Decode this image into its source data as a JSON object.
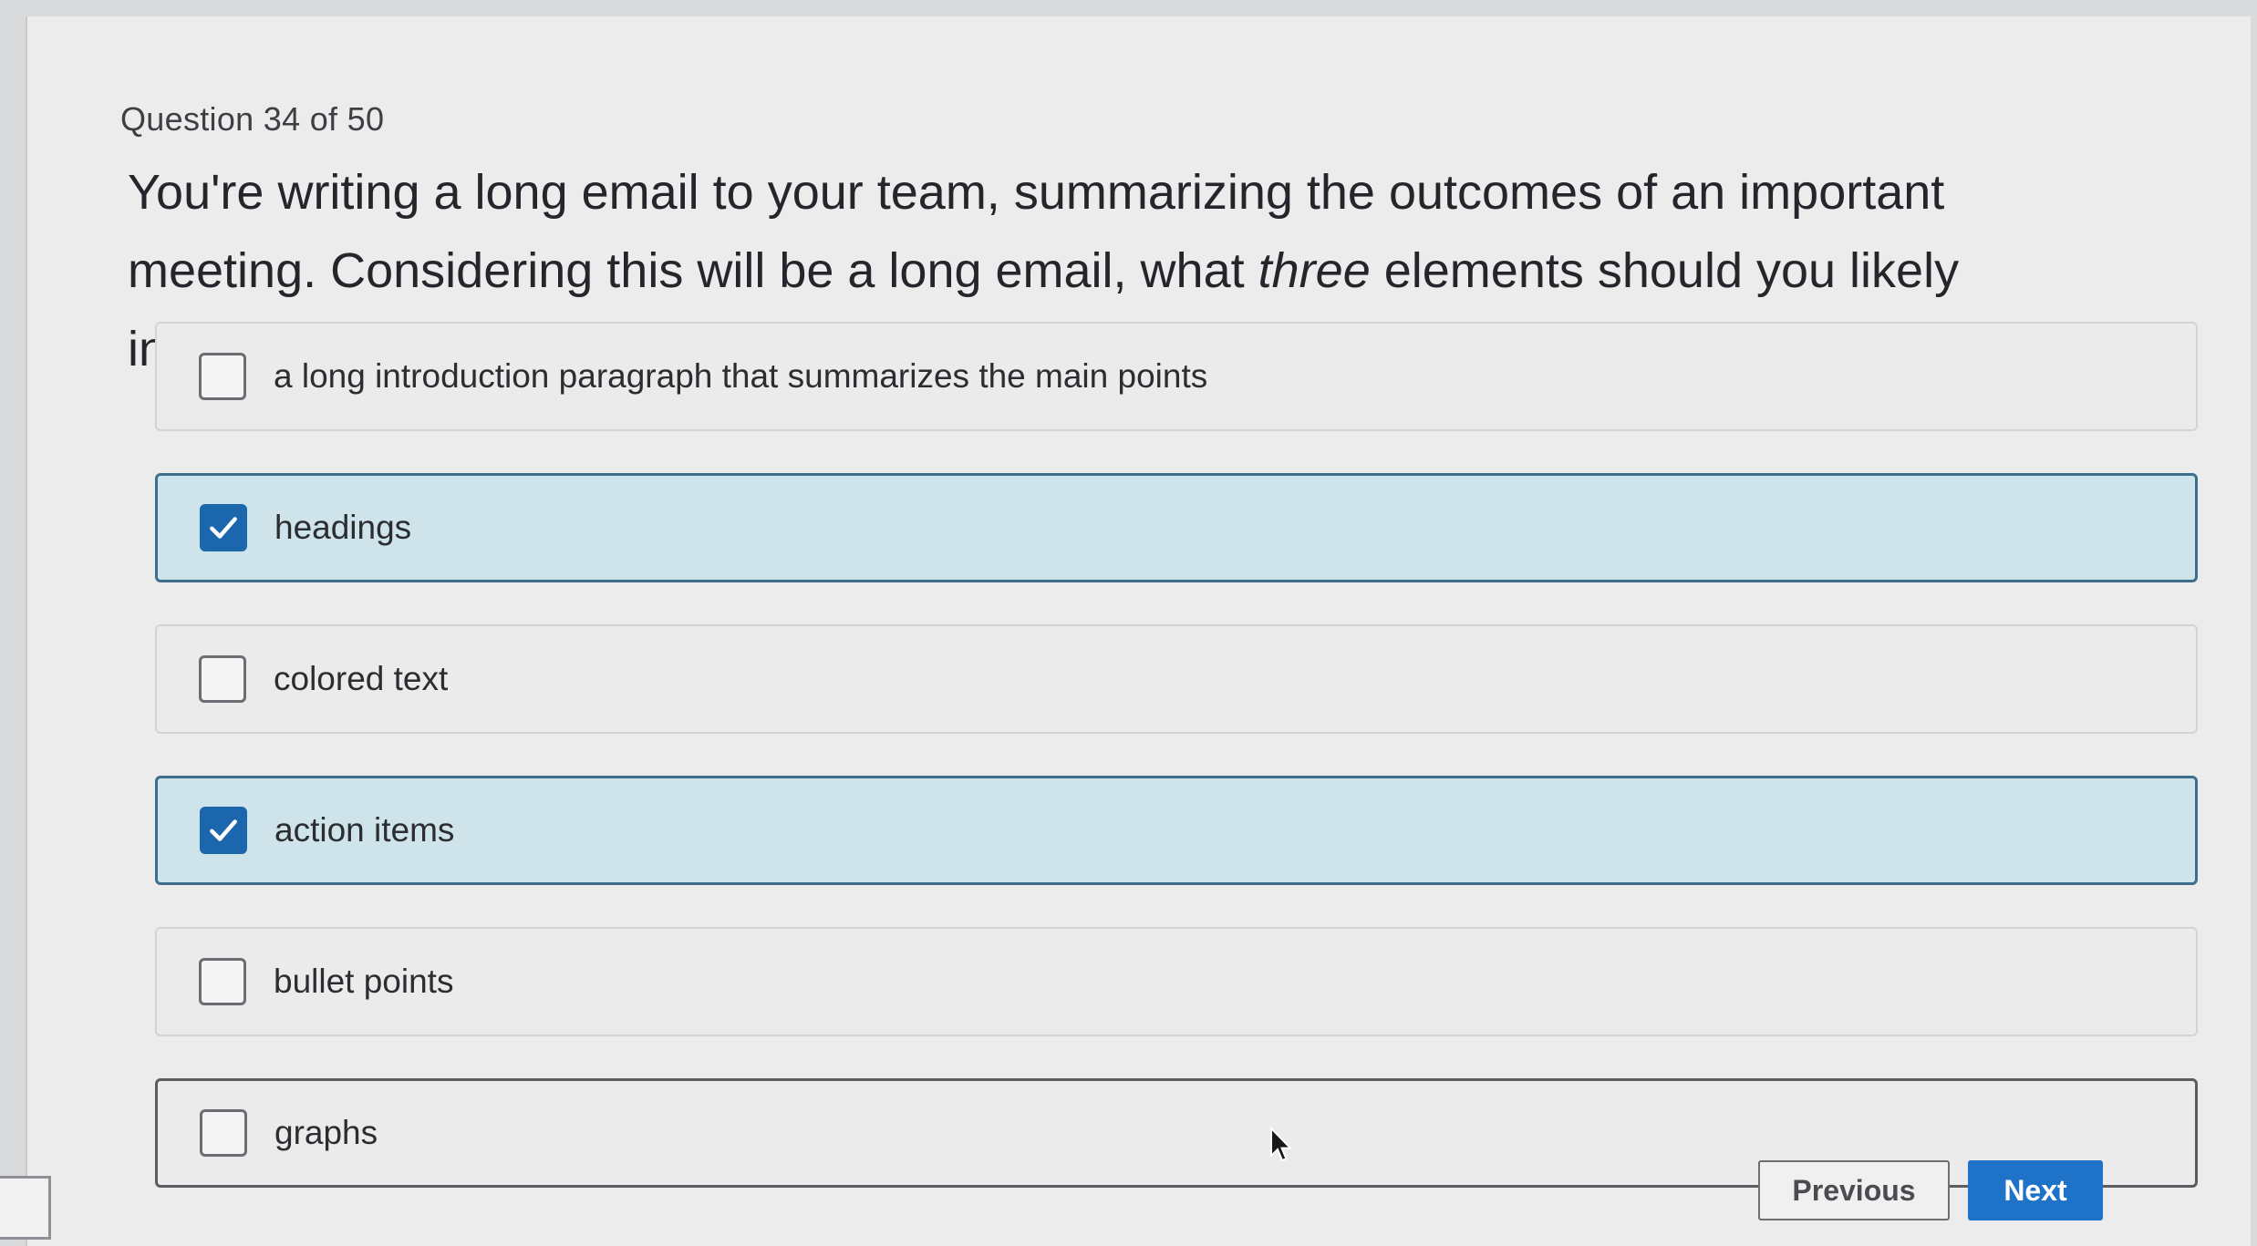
{
  "question": {
    "counter": "Question 34 of 50",
    "text_before": "You're writing a long email to your team, summarizing the outcomes of an important meeting. Considering this will be a long email, what ",
    "text_emphasis": "three",
    "text_after": " elements should you likely include?"
  },
  "options": [
    {
      "label": "a long introduction paragraph that summarizes the main points",
      "checked": false
    },
    {
      "label": "headings",
      "checked": true
    },
    {
      "label": "colored text",
      "checked": false
    },
    {
      "label": "action items",
      "checked": true
    },
    {
      "label": "bullet points",
      "checked": false
    },
    {
      "label": "graphs",
      "checked": false
    }
  ],
  "nav": {
    "previous_label": "Previous",
    "next_label": "Next"
  },
  "colors": {
    "selected_background": "#cfe4ea",
    "checkbox_checked": "#1c66ad",
    "next_button": "#1e73c8"
  },
  "icons": {
    "checkmark": "checkmark-icon",
    "cursor": "mouse-pointer-icon"
  }
}
